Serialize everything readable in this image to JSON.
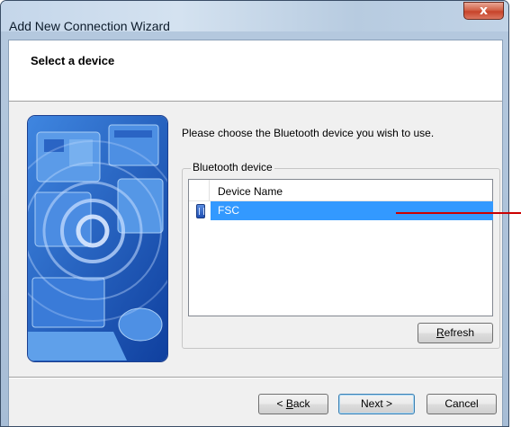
{
  "window": {
    "title": "Add New Connection Wizard",
    "close_glyph": "x"
  },
  "header": {
    "title": "Select a device"
  },
  "content": {
    "instruction": "Please choose the Bluetooth device you wish to use.",
    "group_label": "Bluetooth device",
    "list": {
      "column_header": "Device Name",
      "rows": [
        {
          "name": "FSC",
          "icon": "bluetooth-device-icon",
          "selected": true
        }
      ]
    },
    "refresh_prefix": "R",
    "refresh_rest": "efresh"
  },
  "footer": {
    "back_prefix": "< ",
    "back_accel": "B",
    "back_rest": "ack",
    "next_label": "Next >",
    "cancel_label": "Cancel"
  },
  "colors": {
    "selection": "#3399ff",
    "annotation_line": "#cc0000",
    "illustration_blue": "#1f56b8"
  }
}
